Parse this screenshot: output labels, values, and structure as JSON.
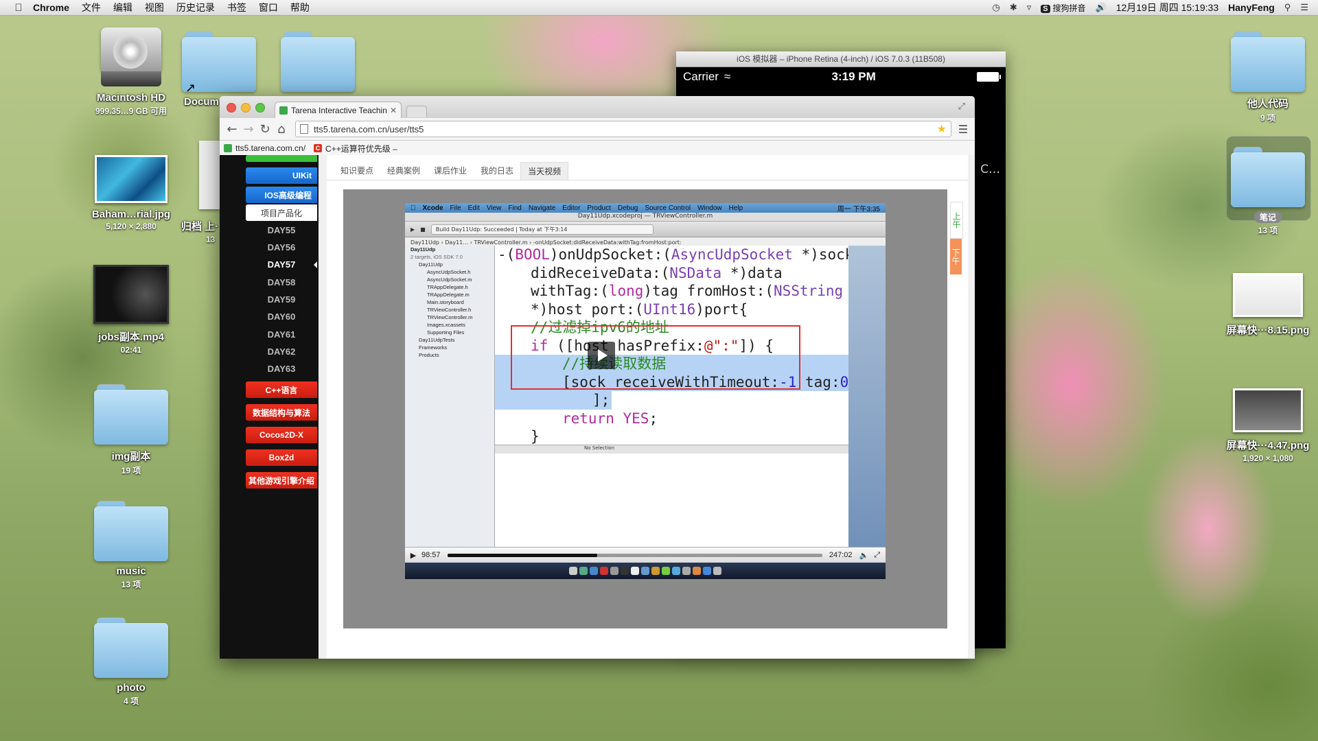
{
  "menubar": {
    "app": "Chrome",
    "items": [
      "文件",
      "编辑",
      "视图",
      "历史记录",
      "书签",
      "窗口",
      "帮助"
    ],
    "ime": "搜狗拼音",
    "datetime": "12月19日 周四  15:19:33",
    "user": "HanyFeng"
  },
  "desktop": {
    "left": [
      {
        "label": "Macintosh HD",
        "sub": "999.35…9 GB 可用"
      },
      {
        "label": "Baham…rial.jpg",
        "sub": "5,120 × 2,880"
      },
      {
        "label": "jobs副本.mp4",
        "sub": "02:41"
      },
      {
        "label": "img副本",
        "sub": "19 项"
      },
      {
        "label": "music",
        "sub": "13 项"
      },
      {
        "label": "photo",
        "sub": "4 项"
      }
    ],
    "partial": [
      {
        "label": "Docum"
      },
      {
        "label": "归档 上·",
        "sub": "13"
      }
    ],
    "right": [
      {
        "label": "他人代码",
        "sub": "9 项"
      },
      {
        "label": "笔记",
        "sub": "13 项"
      },
      {
        "label": "屏幕快···8.15.png",
        "sub": ""
      },
      {
        "label": "屏幕快···4.47.png",
        "sub": "1,920 × 1,080"
      }
    ]
  },
  "simulator": {
    "title": "iOS 模拟器 – iPhone Retina (4-inch) / iOS 7.0.3 (11B508)",
    "carrier": "Carrier",
    "time": "3:19 PM",
    "label_fragment": "C…"
  },
  "chrome": {
    "tab_title": "Tarena Interactive Teachin",
    "url": "tts5.tarena.com.cn/user/tts5",
    "bookmarks": [
      "tts5.tarena.com.cn/",
      "C++运算符优先级 – "
    ]
  },
  "sidenav": {
    "buttons_top": [
      "UIKit",
      "IOS高级编程"
    ],
    "white_button": "项目产品化",
    "days": [
      "DAY55",
      "DAY56",
      "DAY57",
      "DAY58",
      "DAY59",
      "DAY60",
      "DAY61",
      "DAY62",
      "DAY63"
    ],
    "active_day": "DAY57",
    "red_buttons": [
      "C++语言",
      "数据结构与算法",
      "Cocos2D-X",
      "Box2d",
      "其他游戏引擎介绍"
    ]
  },
  "subtabs": [
    "知识要点",
    "经典案例",
    "课后作业",
    "我的日志",
    "当天视频"
  ],
  "active_subtab": "当天视频",
  "side_toggle": {
    "up": "上午",
    "down": "下午"
  },
  "video": {
    "xcode_menu": [
      "Xcode",
      "File",
      "Edit",
      "View",
      "Find",
      "Navigate",
      "Editor",
      "Product",
      "Debug",
      "Source Control",
      "Window",
      "Help"
    ],
    "xcode_clock": "周一 下午3:35",
    "xcode_title": "Day11Udp.xcodeproj — TRViewController.m",
    "build_status": "Build Day11Udp: Succeeded  |  Today at 下午3:14",
    "jump_bar": "Day11Udp › Day11… › TRViewController.m › -onUdpSocket:didReceiveData:withTag:fromHost:port:",
    "navigator": [
      {
        "level": 0,
        "text": "Day11Udp"
      },
      {
        "level": 0,
        "text": "2 targets, iOS SDK 7.0"
      },
      {
        "level": 1,
        "text": "Day11Udp"
      },
      {
        "level": 2,
        "text": "AsyncUdpSocket.h"
      },
      {
        "level": 2,
        "text": "AsyncUdpSocket.m"
      },
      {
        "level": 2,
        "text": "TRAppDelegate.h"
      },
      {
        "level": 2,
        "text": "TRAppDelegate.m"
      },
      {
        "level": 2,
        "text": "Main.storyboard"
      },
      {
        "level": 2,
        "text": "TRViewController.h"
      },
      {
        "level": 2,
        "text": "TRViewController.m"
      },
      {
        "level": 2,
        "text": "Images.xcassets"
      },
      {
        "level": 2,
        "text": "Supporting Files"
      },
      {
        "level": 1,
        "text": "Day11UdpTests"
      },
      {
        "level": 1,
        "text": "Frameworks"
      },
      {
        "level": 1,
        "text": "Products"
      }
    ],
    "debug_text": "No Selection",
    "time_elapsed": "98:57",
    "time_total": "247:02",
    "progress": 0.4
  }
}
